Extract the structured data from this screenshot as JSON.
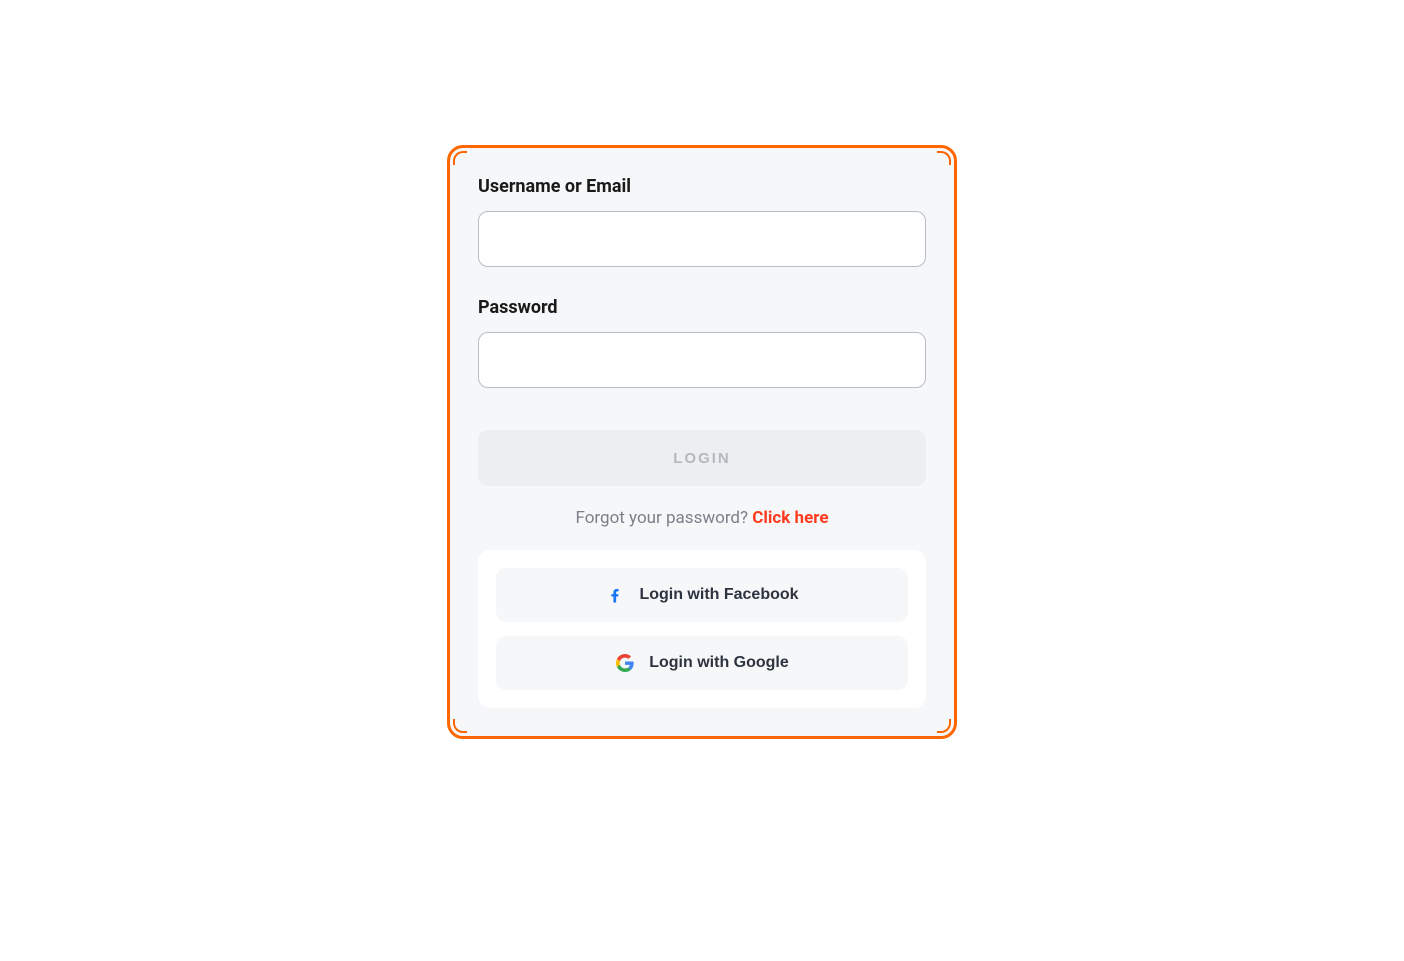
{
  "fields": {
    "username": {
      "label": "Username or Email",
      "value": ""
    },
    "password": {
      "label": "Password",
      "value": ""
    }
  },
  "login_button": "LOGIN",
  "forgot": {
    "question": "Forgot your password? ",
    "link": "Click here"
  },
  "social": {
    "facebook": "Login with Facebook",
    "google": "Login with Google"
  },
  "colors": {
    "accent_border": "#ff6600",
    "link": "#ff3b1f",
    "facebook": "#1877f2"
  }
}
